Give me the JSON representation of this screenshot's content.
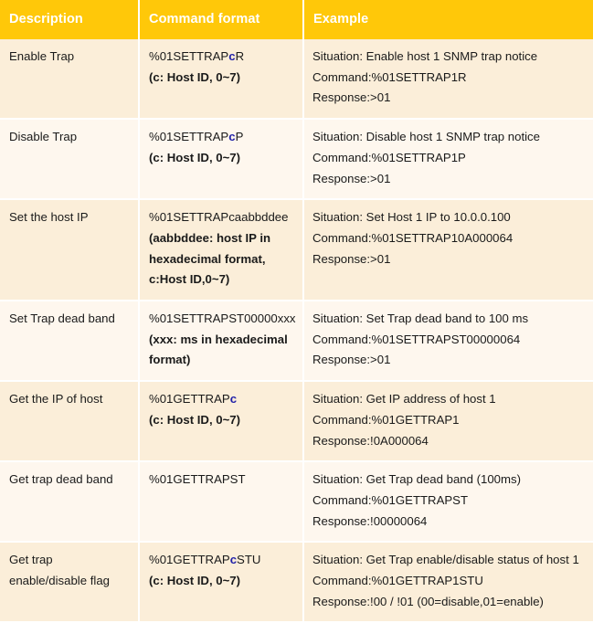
{
  "table": {
    "headers": [
      {
        "label": "Description"
      },
      {
        "label": "Command format"
      },
      {
        "label": "Example"
      }
    ],
    "rows": [
      {
        "description": "Enable Trap",
        "command_prefix": "%01SETTRAP",
        "command_var": "c",
        "command_suffix": "R",
        "command_note": "(c: Host ID, 0~7)",
        "example": {
          "situation": "Situation: Enable host 1 SNMP trap notice",
          "command": "Command:%01SETTRAP1R",
          "response": "Response:>01"
        }
      },
      {
        "description": "Disable Trap",
        "command_prefix": "%01SETTRAP",
        "command_var": "c",
        "command_suffix": "P",
        "command_note": "(c: Host ID, 0~7)",
        "example": {
          "situation": "Situation: Disable host 1 SNMP trap notice",
          "command": "Command:%01SETTRAP1P",
          "response": "Response:>01"
        }
      },
      {
        "description": "Set the host IP",
        "command_prefix": "%01SETTRAPcaabbddee",
        "command_var": "",
        "command_suffix": "",
        "command_note": "(aabbddee: host IP in hexadecimal format, c:Host ID,0~7)",
        "example": {
          "situation": "Situation: Set Host 1 IP to 10.0.0.100",
          "command": "Command:%01SETTRAP10A000064",
          "response": "Response:>01"
        }
      },
      {
        "description": "Set Trap dead band",
        "command_prefix": "%01SETTRAPST00000xxx",
        "command_var": "",
        "command_suffix": "",
        "command_note": "(xxx: ms in hexadecimal format)",
        "example": {
          "situation": "Situation: Set Trap dead band to 100 ms",
          "command": "Command:%01SETTRAPST00000064",
          "response": "Response:>01"
        }
      },
      {
        "description": "Get the IP of host",
        "command_prefix": "%01GETTRAP",
        "command_var": "c",
        "command_suffix": "",
        "command_note": "(c: Host ID, 0~7)",
        "example": {
          "situation": "Situation: Get IP address of host 1",
          "command": "Command:%01GETTRAP1",
          "response": "Response:!0A000064"
        }
      },
      {
        "description": "Get trap dead band",
        "command_prefix": "%01GETTRAPST",
        "command_var": "",
        "command_suffix": "",
        "command_note": "",
        "example": {
          "situation": "Situation: Get Trap dead band (100ms)",
          "command": "Command:%01GETTRAPST",
          "response": "Response:!00000064"
        }
      },
      {
        "description": "Get trap enable/disable flag",
        "command_prefix": "%01GETTRAP",
        "command_var": "c",
        "command_suffix": "STU",
        "command_note": "(c: Host ID, 0~7)",
        "example": {
          "situation": "Situation: Get Trap enable/disable status of host 1",
          "command": "Command:%01GETTRAP1STU",
          "response": "Response:!00 / !01 (00=disable,01=enable)"
        }
      }
    ]
  },
  "colors": {
    "header_bg": "#FFC809",
    "header_text": "#FFFFFF",
    "row_odd_bg": "#FBEED9",
    "row_even_bg": "#FEF7EE",
    "variable_text": "#2121A8",
    "grid_line": "#FFFFFF"
  }
}
